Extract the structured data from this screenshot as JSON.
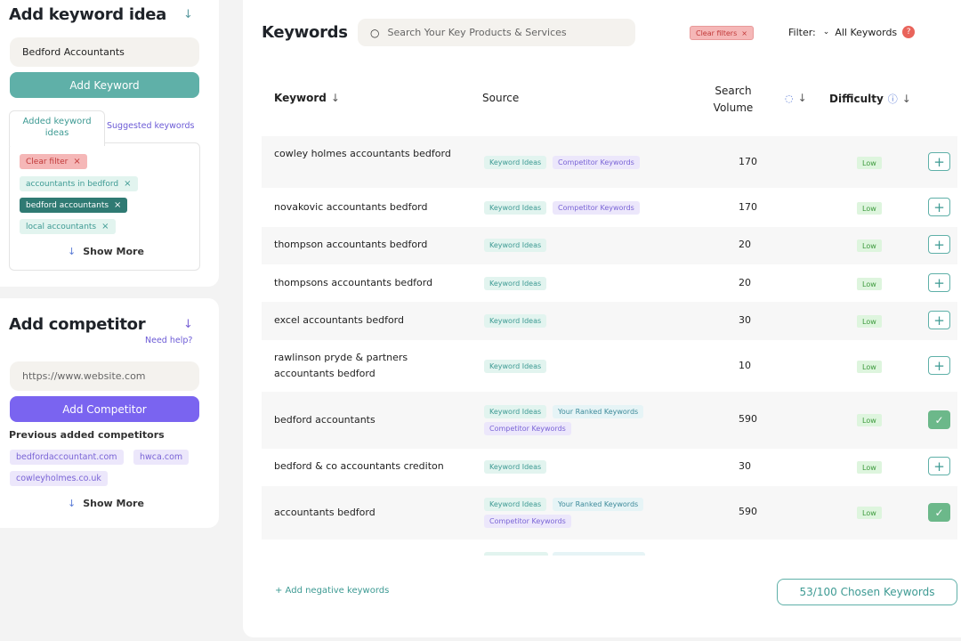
{
  "keyword_panel": {
    "title": "Add keyword idea",
    "input_value": "Bedford Accountants",
    "add_button": "Add Keyword",
    "tabs": [
      {
        "label": "Added keyword ideas",
        "active": true
      },
      {
        "label": "Suggested keywords",
        "active": false
      }
    ],
    "clear_filter": "Clear filter",
    "chips": [
      "accountants in bedford",
      "bedford accountants",
      "local accountants"
    ],
    "show_more": "Show More"
  },
  "competitor_panel": {
    "title": "Add competitor",
    "help_link": "Need help?",
    "input_placeholder": "https://www.website.com",
    "add_button": "Add Competitor",
    "previous_label": "Previous added competitors",
    "competitors": [
      "bedfordaccountant.com",
      "hwca.com",
      "cowleyholmes.co.uk"
    ],
    "show_more": "Show More"
  },
  "main": {
    "title": "Keywords",
    "search_placeholder": "Search Your Key Products & Services",
    "clear_filters": "Clear filters",
    "filter_label": "Filter:",
    "filter_value": "All Keywords",
    "filter_badge": "?",
    "columns": {
      "keyword": "Keyword",
      "source": "Source",
      "search_volume_line1": "Search",
      "search_volume_line2": "Volume",
      "difficulty": "Difficulty"
    },
    "rows": [
      {
        "keyword": "cowley holmes accountants bedford",
        "tags": [
          "Keyword Ideas",
          "Competitor Keywords"
        ],
        "volume": "170",
        "difficulty": "Low",
        "status": "add"
      },
      {
        "keyword": "novakovic accountants bedford",
        "tags": [
          "Keyword Ideas",
          "Competitor Keywords"
        ],
        "volume": "170",
        "difficulty": "Low",
        "status": "add"
      },
      {
        "keyword": "thompson accountants bedford",
        "tags": [
          "Keyword Ideas"
        ],
        "volume": "20",
        "difficulty": "Low",
        "status": "add"
      },
      {
        "keyword": "thompsons accountants bedford",
        "tags": [
          "Keyword Ideas"
        ],
        "volume": "20",
        "difficulty": "Low",
        "status": "add"
      },
      {
        "keyword": "excel accountants bedford",
        "tags": [
          "Keyword Ideas"
        ],
        "volume": "30",
        "difficulty": "Low",
        "status": "add"
      },
      {
        "keyword": "rawlinson pryde & partners accountants bedford",
        "tags": [
          "Keyword Ideas"
        ],
        "volume": "10",
        "difficulty": "Low",
        "status": "add"
      },
      {
        "keyword": "bedford accountants",
        "tags": [
          "Keyword Ideas",
          "Your Ranked Keywords",
          "Competitor Keywords"
        ],
        "volume": "590",
        "difficulty": "Low",
        "status": "added"
      },
      {
        "keyword": "bedford & co accountants crediton",
        "tags": [
          "Keyword Ideas"
        ],
        "volume": "30",
        "difficulty": "Low",
        "status": "add"
      },
      {
        "keyword": "accountants bedford",
        "tags": [
          "Keyword Ideas",
          "Your Ranked Keywords",
          "Competitor Keywords"
        ],
        "volume": "590",
        "difficulty": "Low",
        "status": "added"
      }
    ],
    "negative_link": "+ Add negative keywords",
    "chosen_counter": "53/100 Chosen Keywords"
  },
  "colors": {
    "teal": "#5fb0a8",
    "purple": "#7a64f0",
    "red_chip": "#f5b7b7",
    "low_badge": "#def5de"
  },
  "icons": [
    "arrow-down-icon",
    "search-icon",
    "close-icon",
    "chevron-down-icon",
    "help-icon",
    "sort-icon",
    "info-icon",
    "plus-icon",
    "check-icon"
  ]
}
